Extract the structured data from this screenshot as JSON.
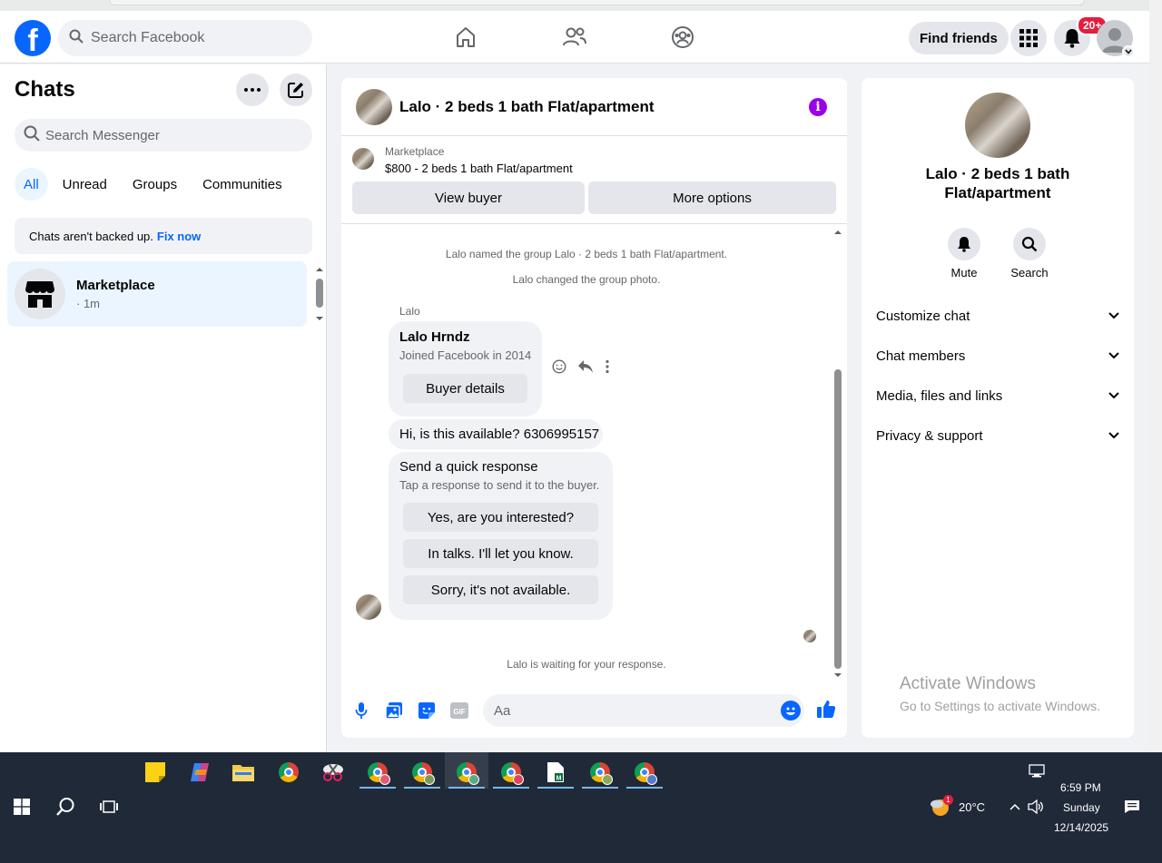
{
  "header": {
    "search_placeholder": "Search Facebook",
    "find_friends_label": "Find friends",
    "notification_count": "20+",
    "logo_letter": "f"
  },
  "sidebar": {
    "title": "Chats",
    "search_placeholder": "Search Messenger",
    "filters": [
      "All",
      "Unread",
      "Groups",
      "Communities"
    ],
    "backup_text": "Chats aren't backed up.",
    "backup_link": "Fix now",
    "chats": [
      {
        "name": "Marketplace",
        "time": "· 1m"
      }
    ]
  },
  "chat": {
    "title": "Lalo · 2 beds 1 bath Flat/apartment",
    "marketplace_label": "Marketplace",
    "listing_price_title": "$800 - 2 beds 1 bath Flat/apartment",
    "view_buyer_label": "View buyer",
    "more_options_label": "More options",
    "system_messages": [
      "Lalo named the group Lalo · 2 beds 1 bath Flat/apartment.",
      "Lalo changed the group photo."
    ],
    "sender_name": "Lalo",
    "profile_card": {
      "name": "Lalo Hrndz",
      "subtitle": "Joined Facebook in 2014",
      "button": "Buyer details"
    },
    "message_text": "Hi, is this available? 6306995157",
    "quick_response": {
      "title": "Send a quick response",
      "subtitle": "Tap a response to send it to the buyer.",
      "options": [
        "Yes, are you interested?",
        "In talks. I'll let you know.",
        "Sorry, it's not available."
      ]
    },
    "waiting_text": "Lalo is waiting for your response.",
    "composer_placeholder": "Aa",
    "gif_label": "GIF"
  },
  "info_panel": {
    "title": "Lalo · 2 beds 1 bath Flat/apartment",
    "actions": [
      {
        "label": "Mute",
        "icon": "bell-icon"
      },
      {
        "label": "Search",
        "icon": "search-icon"
      }
    ],
    "sections": [
      "Customize chat",
      "Chat members",
      "Media, files and links",
      "Privacy & support"
    ]
  },
  "watermark": {
    "line1": "Activate Windows",
    "line2": "Go to Settings to activate Windows."
  },
  "taskbar": {
    "temperature": "20°C",
    "weather_badge": "1",
    "time": "6:59 PM",
    "day": "Sunday",
    "date": "12/14/2025"
  },
  "colors": {
    "fb_blue": "#0866ff",
    "info_purple": "#9b00e8",
    "badge_red": "#e41e3f",
    "taskbar": "#202938"
  }
}
